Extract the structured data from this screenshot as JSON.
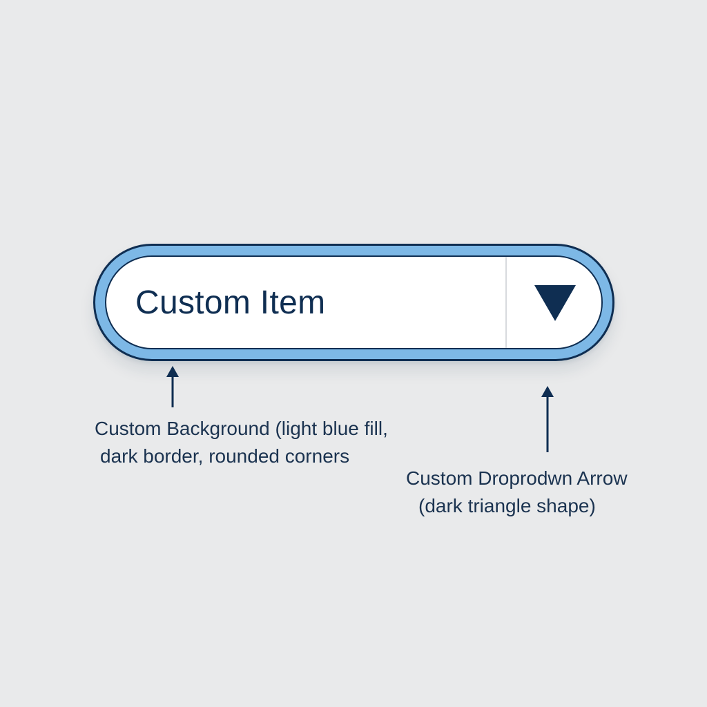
{
  "dropdown": {
    "selected_value": "Custom Item",
    "arrow_icon": "triangle-down-icon"
  },
  "annotations": {
    "background": {
      "line1": "Custom Background (light blue fill,",
      "line2": "dark border, rounded corners"
    },
    "arrow": {
      "line1": "Custom Droprodwn Arrow",
      "line2": "(dark triangle shape)"
    }
  },
  "colors": {
    "page_background": "#e9eaeb",
    "accent_fill": "#7db8e6",
    "border_dark": "#0f2e52",
    "text_dark": "#0f2e52"
  }
}
